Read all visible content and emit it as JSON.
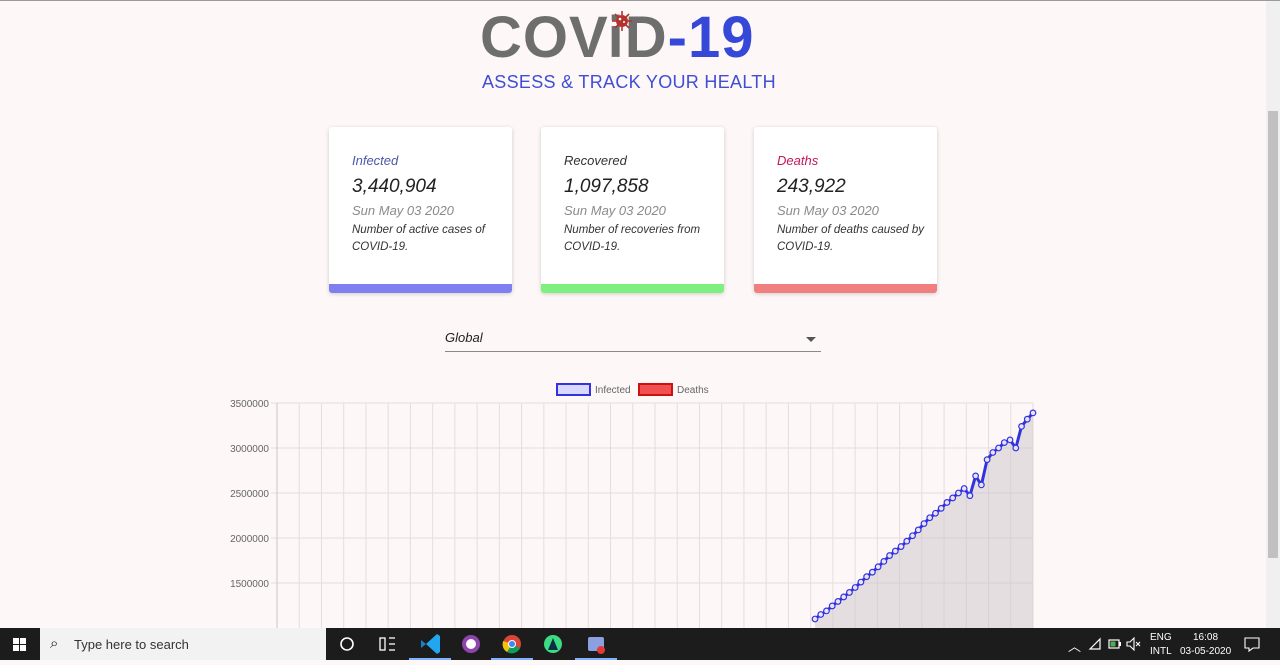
{
  "logo": {
    "part1": "COV",
    "part2": "i",
    "part3": "D",
    "part4": "-19",
    "tagline": "ASSESS & TRACK YOUR HEALTH"
  },
  "cards": [
    {
      "title": "Infected",
      "value": "3,440,904",
      "date": "Sun May 03 2020",
      "desc": "Number of active cases of COVID-19.",
      "color": "#7f7ff0",
      "title_color": "#4a57a8"
    },
    {
      "title": "Recovered",
      "value": "1,097,858",
      "date": "Sun May 03 2020",
      "desc": "Number of recoveries from COVID-19.",
      "color": "#7ff07f",
      "title_color": "#333333"
    },
    {
      "title": "Deaths",
      "value": "243,922",
      "date": "Sun May 03 2020",
      "desc": "Number of deaths caused by COVID-19.",
      "color": "#f07f7f",
      "title_color": "#c2185b"
    }
  ],
  "country_select": {
    "value": "Global"
  },
  "chart_data": {
    "type": "line",
    "legend": [
      "Infected",
      "Deaths"
    ],
    "series": [
      {
        "name": "Infected",
        "color": "#3333dd",
        "values": [
          1100000,
          1150000,
          1190000,
          1245000,
          1295000,
          1345000,
          1395000,
          1450000,
          1510000,
          1570000,
          1620000,
          1680000,
          1740000,
          1805000,
          1855000,
          1905000,
          1965000,
          2025000,
          2090000,
          2160000,
          2225000,
          2275000,
          2330000,
          2395000,
          2445000,
          2500000,
          2550000,
          2470000,
          2690000,
          2590000,
          2870000,
          2950000,
          3000000,
          3060000,
          3090000,
          3000000,
          3240000,
          3320000,
          3390000
        ]
      },
      {
        "name": "Deaths",
        "color": "#dd3333",
        "values": []
      }
    ],
    "y_ticks": [
      "3500000",
      "3000000",
      "2500000",
      "2000000",
      "1500000"
    ],
    "ylim": [
      1000000,
      3500000
    ],
    "grid": true,
    "legend_position": "top"
  },
  "taskbar": {
    "search_placeholder": "Type here to search",
    "lang": "ENG",
    "layout": "INTL",
    "time": "16:08",
    "date": "03-05-2020"
  }
}
